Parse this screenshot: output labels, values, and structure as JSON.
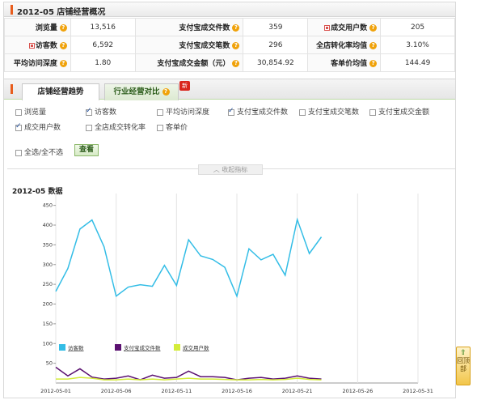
{
  "header": {
    "title": "2012-05 店铺经营概况"
  },
  "stats": [
    [
      {
        "label": "浏览量",
        "value": "13,516",
        "flag": false
      },
      {
        "label": "支付宝成交件数",
        "value": "359",
        "flag": false
      },
      {
        "label": "成交用户数",
        "value": "205",
        "flag": true
      }
    ],
    [
      {
        "label": "访客数",
        "value": "6,592",
        "flag": true
      },
      {
        "label": "支付宝成交笔数",
        "value": "296",
        "flag": false
      },
      {
        "label": "全店转化率均值",
        "value": "3.10%",
        "flag": false
      }
    ],
    [
      {
        "label": "平均访问深度",
        "value": "1.80",
        "flag": false
      },
      {
        "label": "支付宝成交金额（元）",
        "value": "30,854.92",
        "flag": false
      },
      {
        "label": "客单价均值",
        "value": "144.49",
        "flag": false
      }
    ]
  ],
  "tabs": {
    "active": "店铺经营趋势",
    "inactive": "行业经营对比",
    "badge": "新"
  },
  "checkboxes": [
    {
      "label": "浏览量",
      "checked": false
    },
    {
      "label": "访客数",
      "checked": true
    },
    {
      "label": "平均访问深度",
      "checked": false
    },
    {
      "label": "支付宝成交件数",
      "checked": true
    },
    {
      "label": "支付宝成交笔数",
      "checked": false
    },
    {
      "label": "支付宝成交金额",
      "checked": false
    },
    {
      "label": "成交用户数",
      "checked": true
    },
    {
      "label": "全店成交转化率",
      "checked": false
    },
    {
      "label": "客单价",
      "checked": false
    }
  ],
  "select_all": {
    "label": "全选/全不选",
    "checked": false
  },
  "view_button": "查看",
  "collapse_label": "收起指标",
  "chart_title": "2012-05 数据",
  "back_to_top": "回顶部",
  "colors": {
    "visitors": "#33bde6",
    "alipay_items": "#5a1070",
    "buyers": "#d4ec3a"
  },
  "chart_data": {
    "type": "line",
    "title": "2012-05 数据",
    "x": [
      "2012-05-01",
      "2012-05-02",
      "2012-05-03",
      "2012-05-04",
      "2012-05-05",
      "2012-05-06",
      "2012-05-07",
      "2012-05-08",
      "2012-05-09",
      "2012-05-10",
      "2012-05-11",
      "2012-05-12",
      "2012-05-13",
      "2012-05-14",
      "2012-05-15",
      "2012-05-16",
      "2012-05-17",
      "2012-05-18",
      "2012-05-19",
      "2012-05-20",
      "2012-05-21",
      "2012-05-22",
      "2012-05-23"
    ],
    "x_ticks": [
      "2012-05-01",
      "2012-05-06",
      "2012-05-11",
      "2012-05-16",
      "2012-05-21",
      "2012-05-26",
      "2012-05-31"
    ],
    "x_range": [
      "2012-05-01",
      "2012-05-31"
    ],
    "y_ticks": [
      50,
      100,
      150,
      200,
      250,
      300,
      350,
      400,
      450
    ],
    "ylim": [
      0,
      480
    ],
    "grid": "vertical",
    "legend_position": "bottom-left",
    "series": [
      {
        "name": "访客数",
        "color": "#33bde6",
        "values": [
          232,
          290,
          390,
          413,
          345,
          220,
          243,
          249,
          245,
          298,
          247,
          363,
          322,
          313,
          293,
          220,
          340,
          312,
          326,
          273,
          414,
          328,
          370
        ]
      },
      {
        "name": "支付宝成交件数",
        "color": "#5a1070",
        "values": [
          40,
          18,
          36,
          15,
          10,
          12,
          18,
          8,
          20,
          12,
          14,
          30,
          16,
          16,
          14,
          8,
          12,
          14,
          10,
          12,
          18,
          12,
          10
        ]
      },
      {
        "name": "成交用户数",
        "color": "#d4ec3a",
        "values": [
          10,
          10,
          14,
          12,
          8,
          8,
          10,
          8,
          10,
          8,
          10,
          12,
          10,
          10,
          9,
          8,
          8,
          9,
          8,
          9,
          12,
          9,
          8
        ]
      }
    ]
  }
}
